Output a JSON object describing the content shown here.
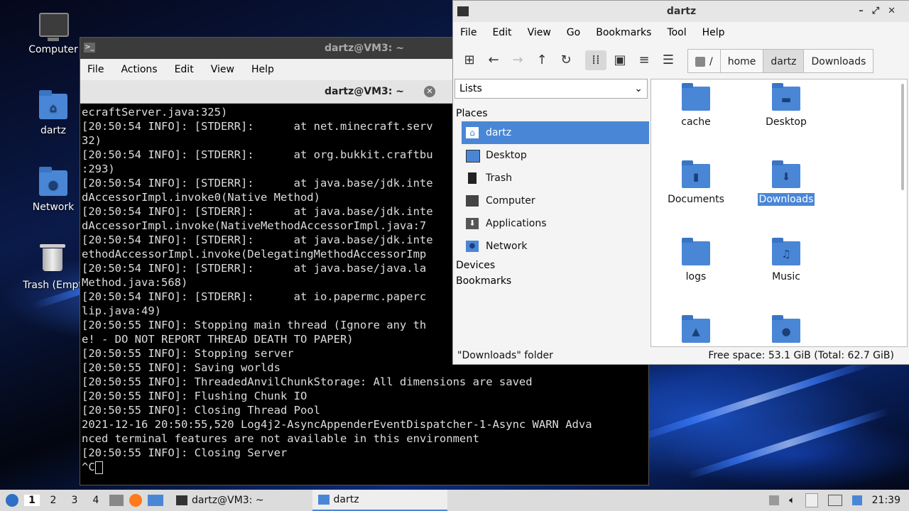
{
  "desktop": {
    "icons": [
      {
        "label": "Computer"
      },
      {
        "label": "dartz"
      },
      {
        "label": "Network"
      },
      {
        "label": "Trash (Empt"
      }
    ]
  },
  "terminal": {
    "title": "dartz@VM3: ~",
    "menu": [
      "File",
      "Actions",
      "Edit",
      "View",
      "Help"
    ],
    "tab_title": "dartz@VM3: ~",
    "lines": [
      "ecraftServer.java:325)",
      "[20:50:54 INFO]: [STDERR]:      at net.minecraft.serv",
      "32)",
      "[20:50:54 INFO]: [STDERR]:      at org.bukkit.craftbu",
      ":293)",
      "[20:50:54 INFO]: [STDERR]:      at java.base/jdk.inte",
      "dAccessorImpl.invoke0(Native Method)",
      "[20:50:54 INFO]: [STDERR]:      at java.base/jdk.inte",
      "dAccessorImpl.invoke(NativeMethodAccessorImpl.java:7",
      "[20:50:54 INFO]: [STDERR]:      at java.base/jdk.inte",
      "ethodAccessorImpl.invoke(DelegatingMethodAccessorImp",
      "[20:50:54 INFO]: [STDERR]:      at java.base/java.la",
      "Method.java:568)",
      "[20:50:54 INFO]: [STDERR]:      at io.papermc.paperc",
      "lip.java:49)",
      "[20:50:55 INFO]: Stopping main thread (Ignore any th",
      "e! - DO NOT REPORT THREAD DEATH TO PAPER)",
      "[20:50:55 INFO]: Stopping server",
      "[20:50:55 INFO]: Saving worlds",
      "[20:50:55 INFO]: ThreadedAnvilChunkStorage: All dimensions are saved",
      "[20:50:55 INFO]: Flushing Chunk IO",
      "[20:50:55 INFO]: Closing Thread Pool",
      "2021-12-16 20:50:55,520 Log4j2-AsyncAppenderEventDispatcher-1-Async WARN Adva",
      "nced terminal features are not available in this environment",
      "[20:50:55 INFO]: Closing Server"
    ],
    "prompt": "^C"
  },
  "filemanager": {
    "title": "dartz",
    "menu": [
      "File",
      "Edit",
      "View",
      "Go",
      "Bookmarks",
      "Tool",
      "Help"
    ],
    "breadcrumbs": [
      "/",
      "home",
      "dartz",
      "Downloads"
    ],
    "side_select": "Lists",
    "places_header": "Places",
    "places": [
      {
        "label": "dartz",
        "icon": "home-icon"
      },
      {
        "label": "Desktop",
        "icon": "desktop-icon"
      },
      {
        "label": "Trash",
        "icon": "trash-icon"
      },
      {
        "label": "Computer",
        "icon": "computer-icon"
      },
      {
        "label": "Applications",
        "icon": "applications-icon"
      },
      {
        "label": "Network",
        "icon": "network-icon"
      }
    ],
    "devices_header": "Devices",
    "bookmarks_header": "Bookmarks",
    "items": [
      {
        "label": "cache",
        "glyph": ""
      },
      {
        "label": "Desktop",
        "glyph": "▬"
      },
      {
        "label": "Documents",
        "glyph": "▮"
      },
      {
        "label": "Downloads",
        "glyph": "⬇"
      },
      {
        "label": "logs",
        "glyph": ""
      },
      {
        "label": "Music",
        "glyph": "♫"
      },
      {
        "label": "",
        "glyph": "▲"
      },
      {
        "label": "",
        "glyph": "●"
      }
    ],
    "status_left": "\"Downloads\" folder",
    "status_right": "Free space: 53.1 GiB (Total: 62.7 GiB)"
  },
  "taskbar": {
    "workspaces": [
      "1",
      "2",
      "3",
      "4"
    ],
    "tasks": [
      {
        "label": "dartz@VM3: ~"
      },
      {
        "label": "dartz"
      }
    ],
    "clock": "21:39"
  }
}
